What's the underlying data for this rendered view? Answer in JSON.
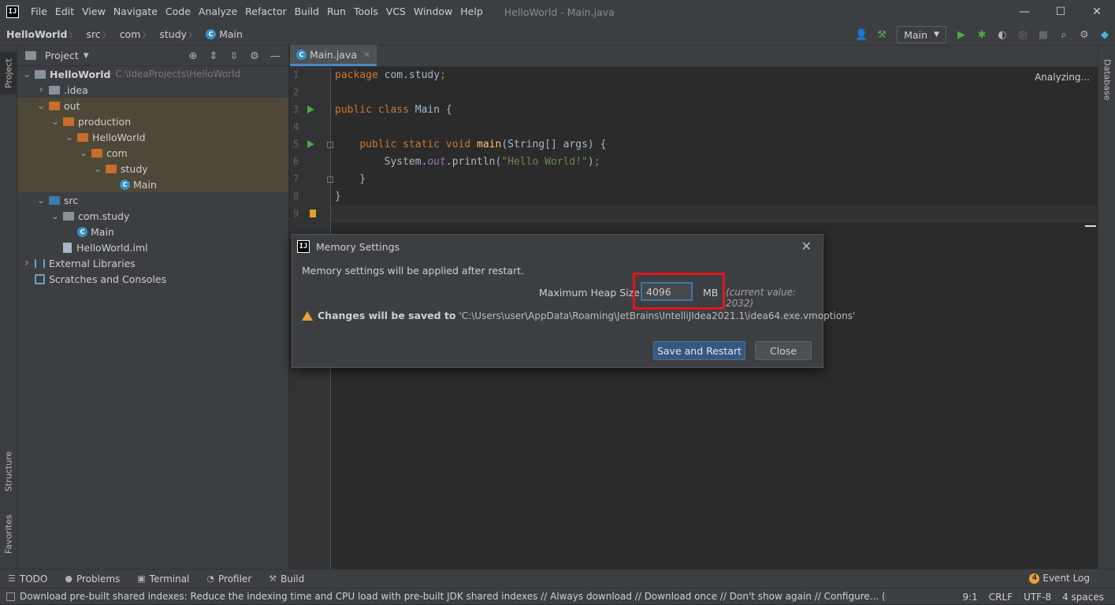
{
  "titlebar": {
    "menu": [
      "File",
      "Edit",
      "View",
      "Navigate",
      "Code",
      "Analyze",
      "Refactor",
      "Build",
      "Run",
      "Tools",
      "VCS",
      "Window",
      "Help"
    ],
    "window_title": "HelloWorld - Main.java"
  },
  "breadcrumb": [
    "HelloWorld",
    "src",
    "com",
    "study",
    "Main"
  ],
  "toolbar": {
    "run_config": "Main"
  },
  "left_tabs": {
    "project": "Project",
    "structure": "Structure",
    "favorites": "Favorites"
  },
  "right_tabs": {
    "database": "Database"
  },
  "project_panel": {
    "title": "Project",
    "tree": [
      {
        "label": "HelloWorld",
        "hint": "C:\\IdeaProjects\\HelloWorld",
        "depth": 0,
        "arrow": "down",
        "icon": "module-folder-icon"
      },
      {
        "label": ".idea",
        "depth": 1,
        "arrow": "right",
        "icon": "folder-icon"
      },
      {
        "label": "out",
        "depth": 1,
        "arrow": "down",
        "icon": "folder-orange-icon",
        "hl": true
      },
      {
        "label": "production",
        "depth": 2,
        "arrow": "down",
        "icon": "folder-orange-icon",
        "hl": true
      },
      {
        "label": "HelloWorld",
        "depth": 3,
        "arrow": "down",
        "icon": "folder-orange-icon",
        "hl": true
      },
      {
        "label": "com",
        "depth": 4,
        "arrow": "down",
        "icon": "folder-orange-icon",
        "hl": true
      },
      {
        "label": "study",
        "depth": 5,
        "arrow": "down",
        "icon": "folder-orange-icon",
        "hl": true
      },
      {
        "label": "Main",
        "depth": 6,
        "arrow": "",
        "icon": "class-icon",
        "hl": true
      },
      {
        "label": "src",
        "depth": 1,
        "arrow": "down",
        "icon": "folder-blue-icon"
      },
      {
        "label": "com.study",
        "depth": 2,
        "arrow": "down",
        "icon": "package-icon"
      },
      {
        "label": "Main",
        "depth": 3,
        "arrow": "",
        "icon": "class-icon"
      },
      {
        "label": "HelloWorld.iml",
        "depth": 2,
        "arrow": "",
        "icon": "file-icon"
      },
      {
        "label": "External Libraries",
        "depth": 0,
        "arrow": "right",
        "icon": "library-icon"
      },
      {
        "label": "Scratches and Consoles",
        "depth": 0,
        "arrow": "",
        "icon": "scratch-icon"
      }
    ]
  },
  "editor": {
    "tab": "Main.java",
    "status": "Analyzing...",
    "lines": [
      "1",
      "2",
      "3",
      "4",
      "5",
      "6",
      "7",
      "8",
      "9"
    ]
  },
  "dialog": {
    "title": "Memory Settings",
    "message": "Memory settings will be applied after restart.",
    "heap_label": "Maximum Heap Size:",
    "heap_value": "4096",
    "unit": "MB",
    "current_value": "(current value: 2032)",
    "warning_bold": "Changes will be saved to",
    "warning_path": "'C:\\Users\\user\\AppData\\Roaming\\JetBrains\\IntelliJIdea2021.1\\idea64.exe.vmoptions'",
    "save_restart": "Save and Restart",
    "close": "Close"
  },
  "bottom_tools": [
    "TODO",
    "Problems",
    "Terminal",
    "Profiler",
    "Build"
  ],
  "event_log": {
    "count": "4",
    "label": "Event Log"
  },
  "status": {
    "message": "Download pre-built shared indexes: Reduce the indexing time and CPU load with pre-built JDK shared indexes // Always download // Download once // Don't show again // Configure... (moments ago)",
    "position": "9:1",
    "line_sep": "CRLF",
    "encoding": "UTF-8",
    "indent": "4 spaces"
  }
}
